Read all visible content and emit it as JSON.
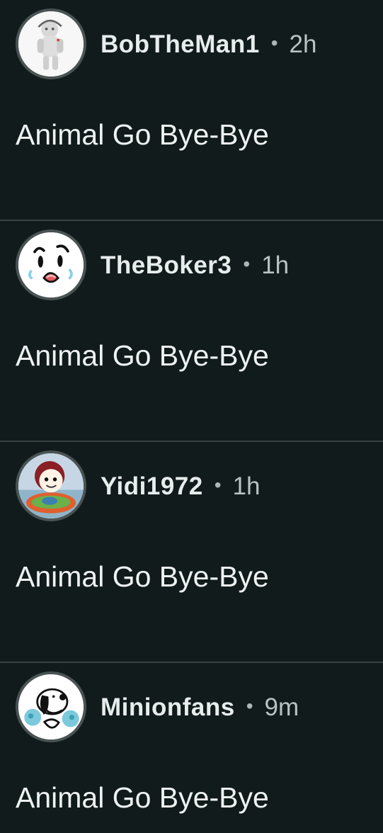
{
  "posts": [
    {
      "username": "BobTheMan1",
      "separator": "•",
      "time": "2h",
      "text": "Animal Go Bye-Bye",
      "avatar_icon": "robot-figure-avatar"
    },
    {
      "username": "TheBoker3",
      "separator": "•",
      "time": "1h",
      "text": "Animal Go Bye-Bye",
      "avatar_icon": "surprised-face-avatar"
    },
    {
      "username": "Yidi1972",
      "separator": "•",
      "time": "1h",
      "text": "Animal Go Bye-Bye",
      "avatar_icon": "cartoon-character-avatar"
    },
    {
      "username": "Minionfans",
      "separator": "•",
      "time": "9m",
      "text": "Animal Go Bye-Bye",
      "avatar_icon": "snoopy-avatar"
    }
  ],
  "colors": {
    "background": "#111b1b",
    "divider": "#3a4344",
    "avatar_border": "#4a5354",
    "username": "#e7ecec",
    "time": "#bac2c2",
    "text": "#eef2f2"
  }
}
